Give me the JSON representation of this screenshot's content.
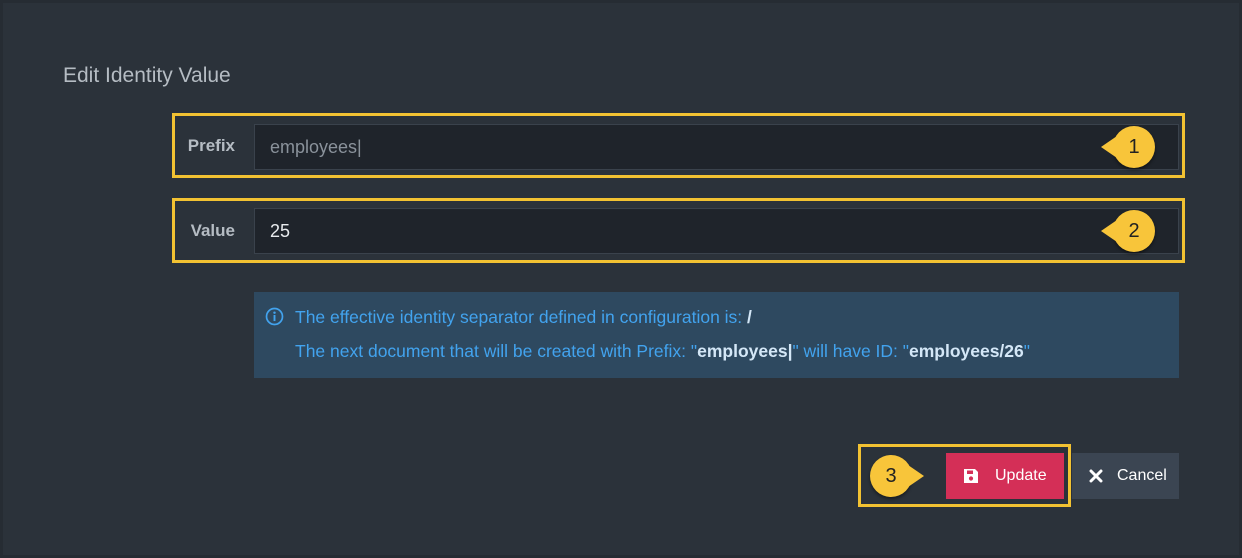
{
  "dialog": {
    "title": "Edit Identity Value"
  },
  "prefix_field": {
    "label": "Prefix",
    "value": "employees|"
  },
  "value_field": {
    "label": "Value",
    "value": "25"
  },
  "info": {
    "line1_text": "The effective identity separator defined in configuration is: ",
    "separator": "/",
    "line2_text_a": "The next document that will be created with Prefix: \"",
    "prefix": "employees|",
    "line2_text_b": "\" will have ID: \"",
    "next_id": "employees/26",
    "line2_text_c": "\""
  },
  "buttons": {
    "update_label": "Update",
    "cancel_label": "Cancel"
  },
  "callouts": {
    "one": "1",
    "two": "2",
    "three": "3"
  },
  "icons": {
    "info": "info-circle-icon",
    "save": "floppy-save-icon",
    "cancel": "close-x-icon"
  },
  "colors": {
    "highlight": "#f2c232",
    "callout": "#f8c53a",
    "update_button": "#d42f57",
    "cancel_button": "#3b4552",
    "info_bg": "#2e4960",
    "info_text": "#42a3ee"
  }
}
